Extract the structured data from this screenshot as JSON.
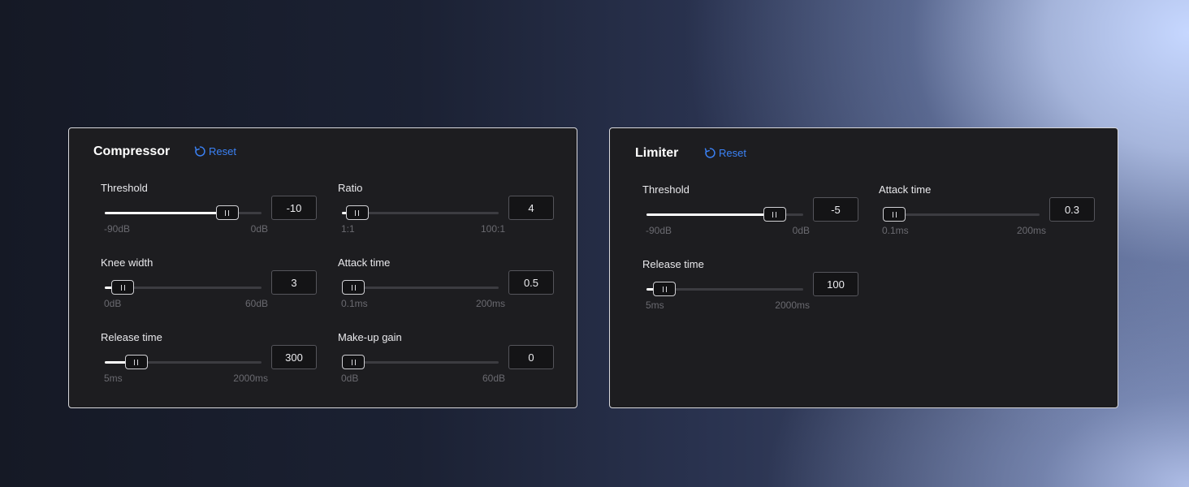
{
  "compressor": {
    "title": "Compressor",
    "reset_label": "Reset",
    "controls": [
      {
        "label": "Threshold",
        "value": "-10",
        "min": "-90dB",
        "max": "0dB",
        "level": 0.83
      },
      {
        "label": "Ratio",
        "value": "4",
        "min": "1:1",
        "max": "100:1",
        "level": 0.03
      },
      {
        "label": "Knee width",
        "value": "3",
        "min": "0dB",
        "max": "60dB",
        "level": 0.05
      },
      {
        "label": "Attack time",
        "value": "0.5",
        "min": "0.1ms",
        "max": "200ms",
        "level": 0.0
      },
      {
        "label": "Release time",
        "value": "300",
        "min": "5ms",
        "max": "2000ms",
        "level": 0.15
      },
      {
        "label": "Make-up gain",
        "value": "0",
        "min": "0dB",
        "max": "60dB",
        "level": 0.0
      }
    ]
  },
  "limiter": {
    "title": "Limiter",
    "reset_label": "Reset",
    "controls": [
      {
        "label": "Threshold",
        "value": "-5",
        "min": "-90dB",
        "max": "0dB",
        "level": 0.87
      },
      {
        "label": "Attack time",
        "value": "0.3",
        "min": "0.1ms",
        "max": "200ms",
        "level": 0.0
      },
      {
        "label": "Release time",
        "value": "100",
        "min": "5ms",
        "max": "2000ms",
        "level": 0.05
      }
    ]
  },
  "colors": {
    "accent": "#3b82f6",
    "panel": "#1d1d20",
    "fill": "#ffffff",
    "track": "#3c3c41"
  },
  "icons": {
    "reset": "reset-icon",
    "thumb": "grip-icon"
  }
}
